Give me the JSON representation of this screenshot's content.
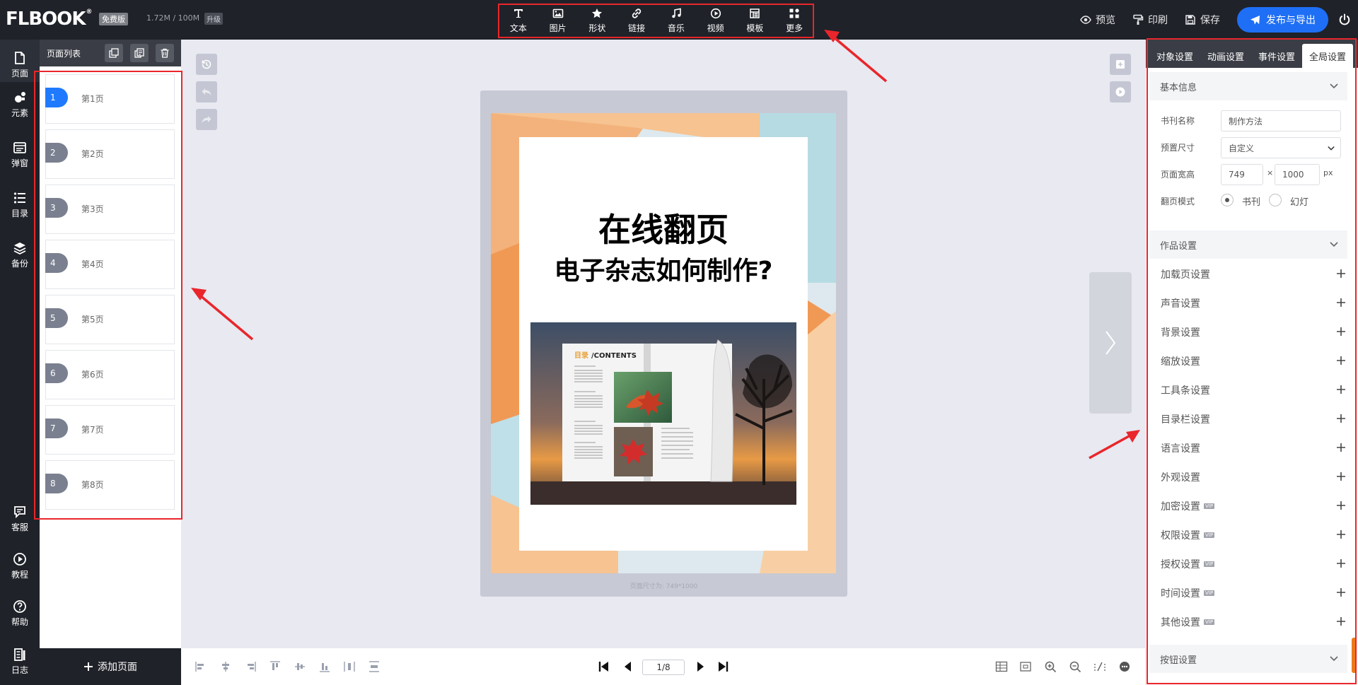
{
  "app": {
    "logo": "FLBOOK",
    "logo_mark": "®",
    "plan_badge": "免费版",
    "storage": "1.72M / 100M",
    "upgrade": "升级"
  },
  "toolbar": {
    "items": [
      {
        "label": "文本",
        "icon": "text-icon"
      },
      {
        "label": "图片",
        "icon": "image-icon"
      },
      {
        "label": "形状",
        "icon": "star-icon"
      },
      {
        "label": "链接",
        "icon": "link-icon"
      },
      {
        "label": "音乐",
        "icon": "music-icon"
      },
      {
        "label": "视频",
        "icon": "play-icon"
      },
      {
        "label": "模板",
        "icon": "template-icon"
      },
      {
        "label": "更多",
        "icon": "more-icon"
      }
    ]
  },
  "top_actions": {
    "preview": "预览",
    "print": "印刷",
    "save": "保存",
    "publish": "发布与导出"
  },
  "left_nav": {
    "items": [
      "页面",
      "元素",
      "弹窗",
      "目录",
      "备份"
    ],
    "bottom": [
      "客服",
      "教程",
      "帮助",
      "日志"
    ]
  },
  "pages_panel": {
    "title": "页面列表",
    "add_page": "添加页面",
    "active_page": 1,
    "pages": [
      {
        "num": "1",
        "label": "第1页"
      },
      {
        "num": "2",
        "label": "第2页"
      },
      {
        "num": "3",
        "label": "第3页"
      },
      {
        "num": "4",
        "label": "第4页"
      },
      {
        "num": "5",
        "label": "第5页"
      },
      {
        "num": "6",
        "label": "第6页"
      },
      {
        "num": "7",
        "label": "第7页"
      },
      {
        "num": "8",
        "label": "第8页"
      }
    ]
  },
  "canvas": {
    "title_line1": "在线翻页",
    "title_line2": "电子杂志如何制作?",
    "photo_contents_label_highlight": "目录",
    "photo_contents_label": "/CONTENTS",
    "size_note": "页面尺寸为: 749*1000"
  },
  "pager": {
    "value": "1/8"
  },
  "right_panel": {
    "tabs": [
      "对象设置",
      "动画设置",
      "事件设置",
      "全局设置"
    ],
    "active_tab": 3,
    "basic_info": {
      "heading": "基本信息",
      "book_name_label": "书刊名称",
      "book_name_value": "制作方法",
      "preset_label": "预置尺寸",
      "preset_value": "自定义",
      "size_label": "页面宽高",
      "width": "749",
      "times": "×",
      "height": "1000",
      "unit": "px",
      "flip_label": "翻页模式",
      "flip_options": [
        "书刊",
        "幻灯"
      ],
      "flip_selected": "书刊"
    },
    "work_settings_heading": "作品设置",
    "settings": [
      {
        "label": "加载页设置",
        "vip": ""
      },
      {
        "label": "声音设置",
        "vip": ""
      },
      {
        "label": "背景设置",
        "vip": ""
      },
      {
        "label": "缩放设置",
        "vip": ""
      },
      {
        "label": "工具条设置",
        "vip": ""
      },
      {
        "label": "目录栏设置",
        "vip": ""
      },
      {
        "label": "语言设置",
        "vip": ""
      },
      {
        "label": "外观设置",
        "vip": ""
      },
      {
        "label": "加密设置",
        "vip": "VIP"
      },
      {
        "label": "权限设置",
        "vip": "VIP"
      },
      {
        "label": "授权设置",
        "vip": "VIP"
      },
      {
        "label": "时间设置",
        "vip": "VIP"
      },
      {
        "label": "其他设置",
        "vip": "VIP"
      }
    ],
    "button_settings_heading": "按钮设置"
  },
  "colors": {
    "topbar": "#1f2229",
    "accent": "#1e6ff5",
    "highlight": "#e9262b",
    "active_page": "#1f7aff"
  }
}
